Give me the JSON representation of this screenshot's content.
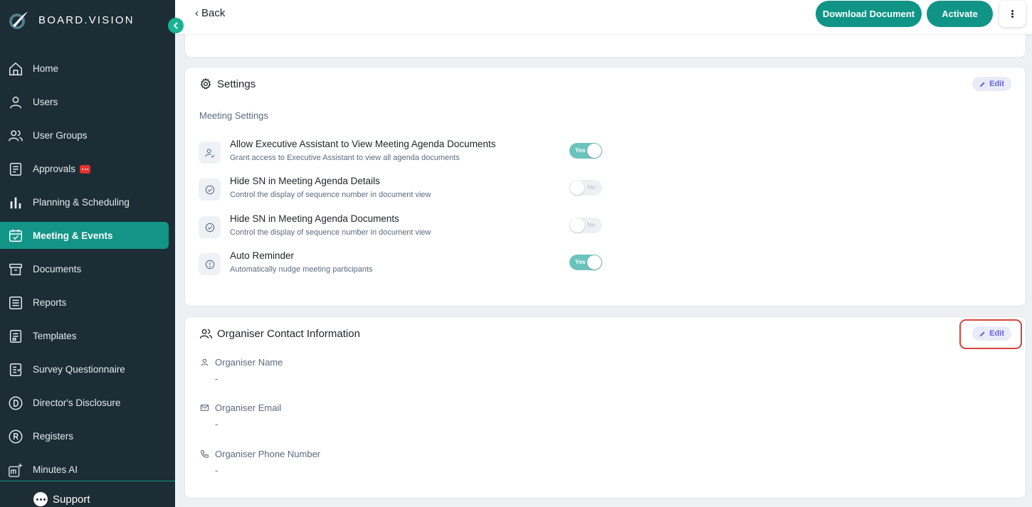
{
  "brand": {
    "name": "BOARD.VISION"
  },
  "sidebar": {
    "items": [
      {
        "label": "Home",
        "icon": "home-icon"
      },
      {
        "label": "Users",
        "icon": "user-icon"
      },
      {
        "label": "User Groups",
        "icon": "users-icon"
      },
      {
        "label": "Approvals",
        "icon": "approvals-icon"
      },
      {
        "label": "Planning & Scheduling",
        "icon": "bar-chart-icon"
      },
      {
        "label": "Meeting & Events",
        "icon": "calendar-check-icon",
        "active": true
      },
      {
        "label": "Documents",
        "icon": "archive-icon"
      },
      {
        "label": "Reports",
        "icon": "list-icon"
      },
      {
        "label": "Templates",
        "icon": "template-icon"
      },
      {
        "label": "Survey Questionnaire",
        "icon": "survey-icon"
      },
      {
        "label": "Director's Disclosure",
        "icon": "letter-d-icon"
      },
      {
        "label": "Registers",
        "icon": "letter-r-icon"
      },
      {
        "label": "Minutes AI",
        "icon": "minutes-ai-icon"
      }
    ],
    "support_label": "Support"
  },
  "topbar": {
    "back_label": "Back",
    "download_label": "Download Document",
    "activate_label": "Activate"
  },
  "settings": {
    "title": "Settings",
    "edit_label": "Edit",
    "section_label": "Meeting Settings",
    "rows": [
      {
        "title": "Allow Executive Assistant to View Meeting Agenda Documents",
        "desc": "Grant access to Executive Assistant to view all agenda documents",
        "toggle": "Yes"
      },
      {
        "title": "Hide SN in Meeting Agenda Details",
        "desc": "Control the display of sequence number in document view",
        "toggle": "No"
      },
      {
        "title": "Hide SN in Meeting Agenda Documents",
        "desc": "Control the display of sequence number in document view",
        "toggle": "No"
      },
      {
        "title": "Auto Reminder",
        "desc": "Automatically nudge meeting participants",
        "toggle": "Yes"
      }
    ]
  },
  "organiser": {
    "title": "Organiser Contact Information",
    "edit_label": "Edit",
    "fields": [
      {
        "label": "Organiser Name",
        "value": "-"
      },
      {
        "label": "Organiser Email",
        "value": "-"
      },
      {
        "label": "Organiser Phone Number",
        "value": "-"
      }
    ]
  },
  "colors": {
    "sidebar_bg": "#1c2d35",
    "accent": "#109486",
    "edit_text": "#6466d6",
    "highlight": "#d4453d"
  }
}
